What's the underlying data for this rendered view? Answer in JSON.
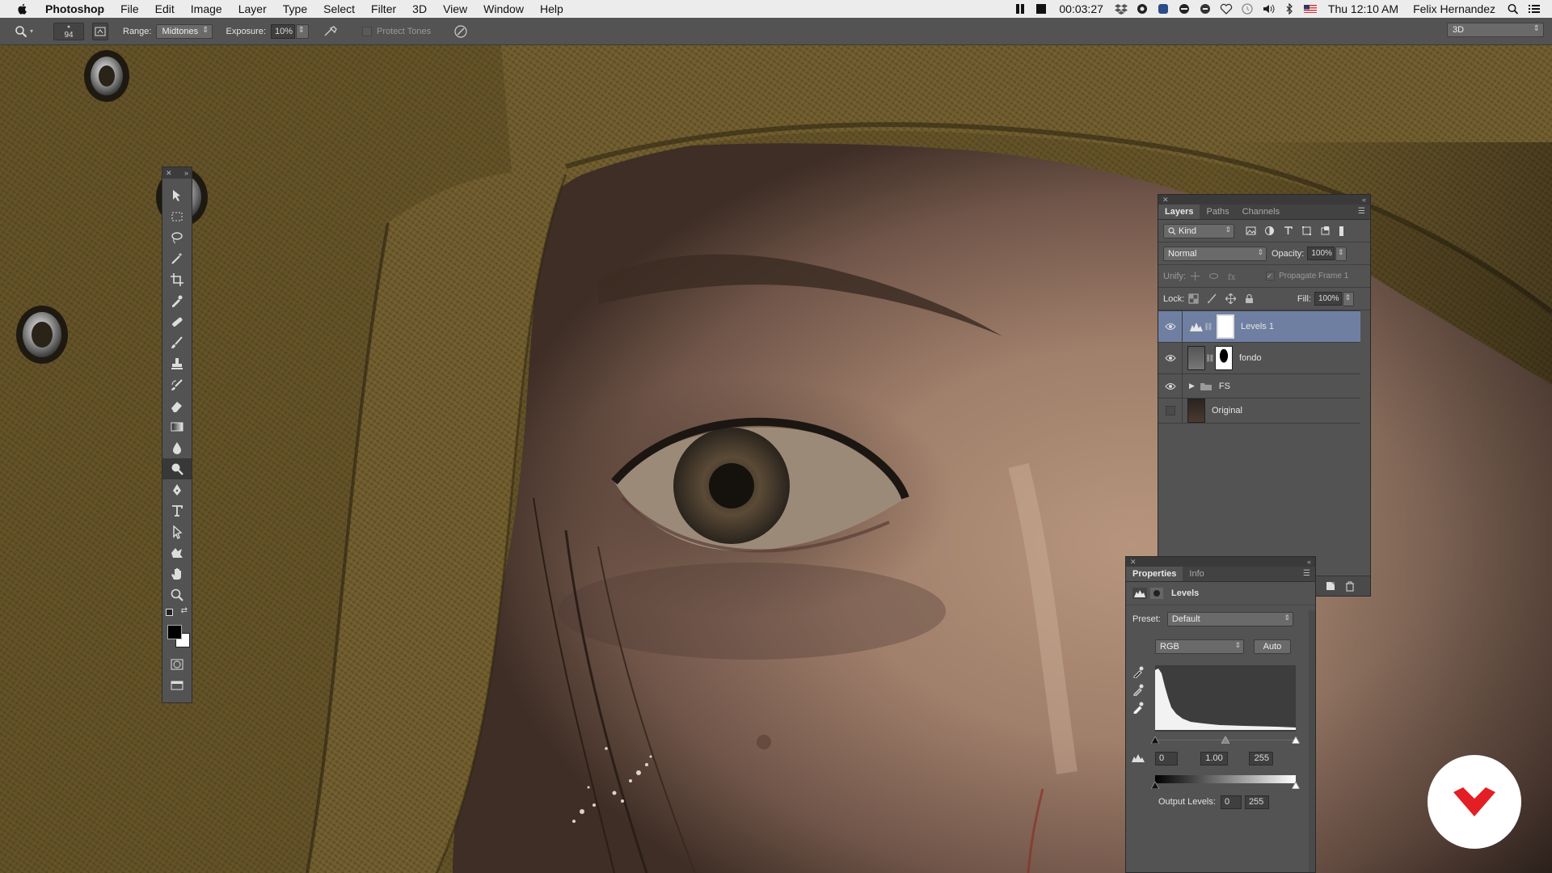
{
  "menubar": {
    "app": "Photoshop",
    "menus": [
      "File",
      "Edit",
      "Image",
      "Layer",
      "Type",
      "Select",
      "Filter",
      "3D",
      "View",
      "Window",
      "Help"
    ],
    "timer": "00:03:27",
    "clock": "Thu 12:10 AM",
    "user": "Felix Hernandez"
  },
  "options": {
    "brush_size": "94",
    "range_label": "Range:",
    "range_value": "Midtones",
    "exposure_label": "Exposure:",
    "exposure_value": "10%",
    "protect_tones": "Protect Tones",
    "workspace": "3D"
  },
  "layers_panel": {
    "tabs": [
      "Layers",
      "Paths",
      "Channels"
    ],
    "filter_kind": "Kind",
    "blend_mode": "Normal",
    "opacity_label": "Opacity:",
    "opacity_value": "100%",
    "unify_label": "Unify:",
    "propagate": "Propagate Frame 1",
    "lock_label": "Lock:",
    "fill_label": "Fill:",
    "fill_value": "100%",
    "layers": [
      {
        "name": "Levels 1",
        "visible": true,
        "selected": true
      },
      {
        "name": "fondo",
        "visible": true,
        "selected": false
      },
      {
        "name": "FS",
        "visible": true,
        "selected": false
      },
      {
        "name": "Original",
        "visible": false,
        "selected": false
      }
    ]
  },
  "properties_panel": {
    "tabs": [
      "Properties",
      "Info"
    ],
    "title": "Levels",
    "preset_label": "Preset:",
    "preset_value": "Default",
    "channel": "RGB",
    "auto_button": "Auto",
    "input_black": "0",
    "input_gamma": "1.00",
    "input_white": "255",
    "output_label": "Output Levels:",
    "output_black": "0",
    "output_white": "255"
  }
}
